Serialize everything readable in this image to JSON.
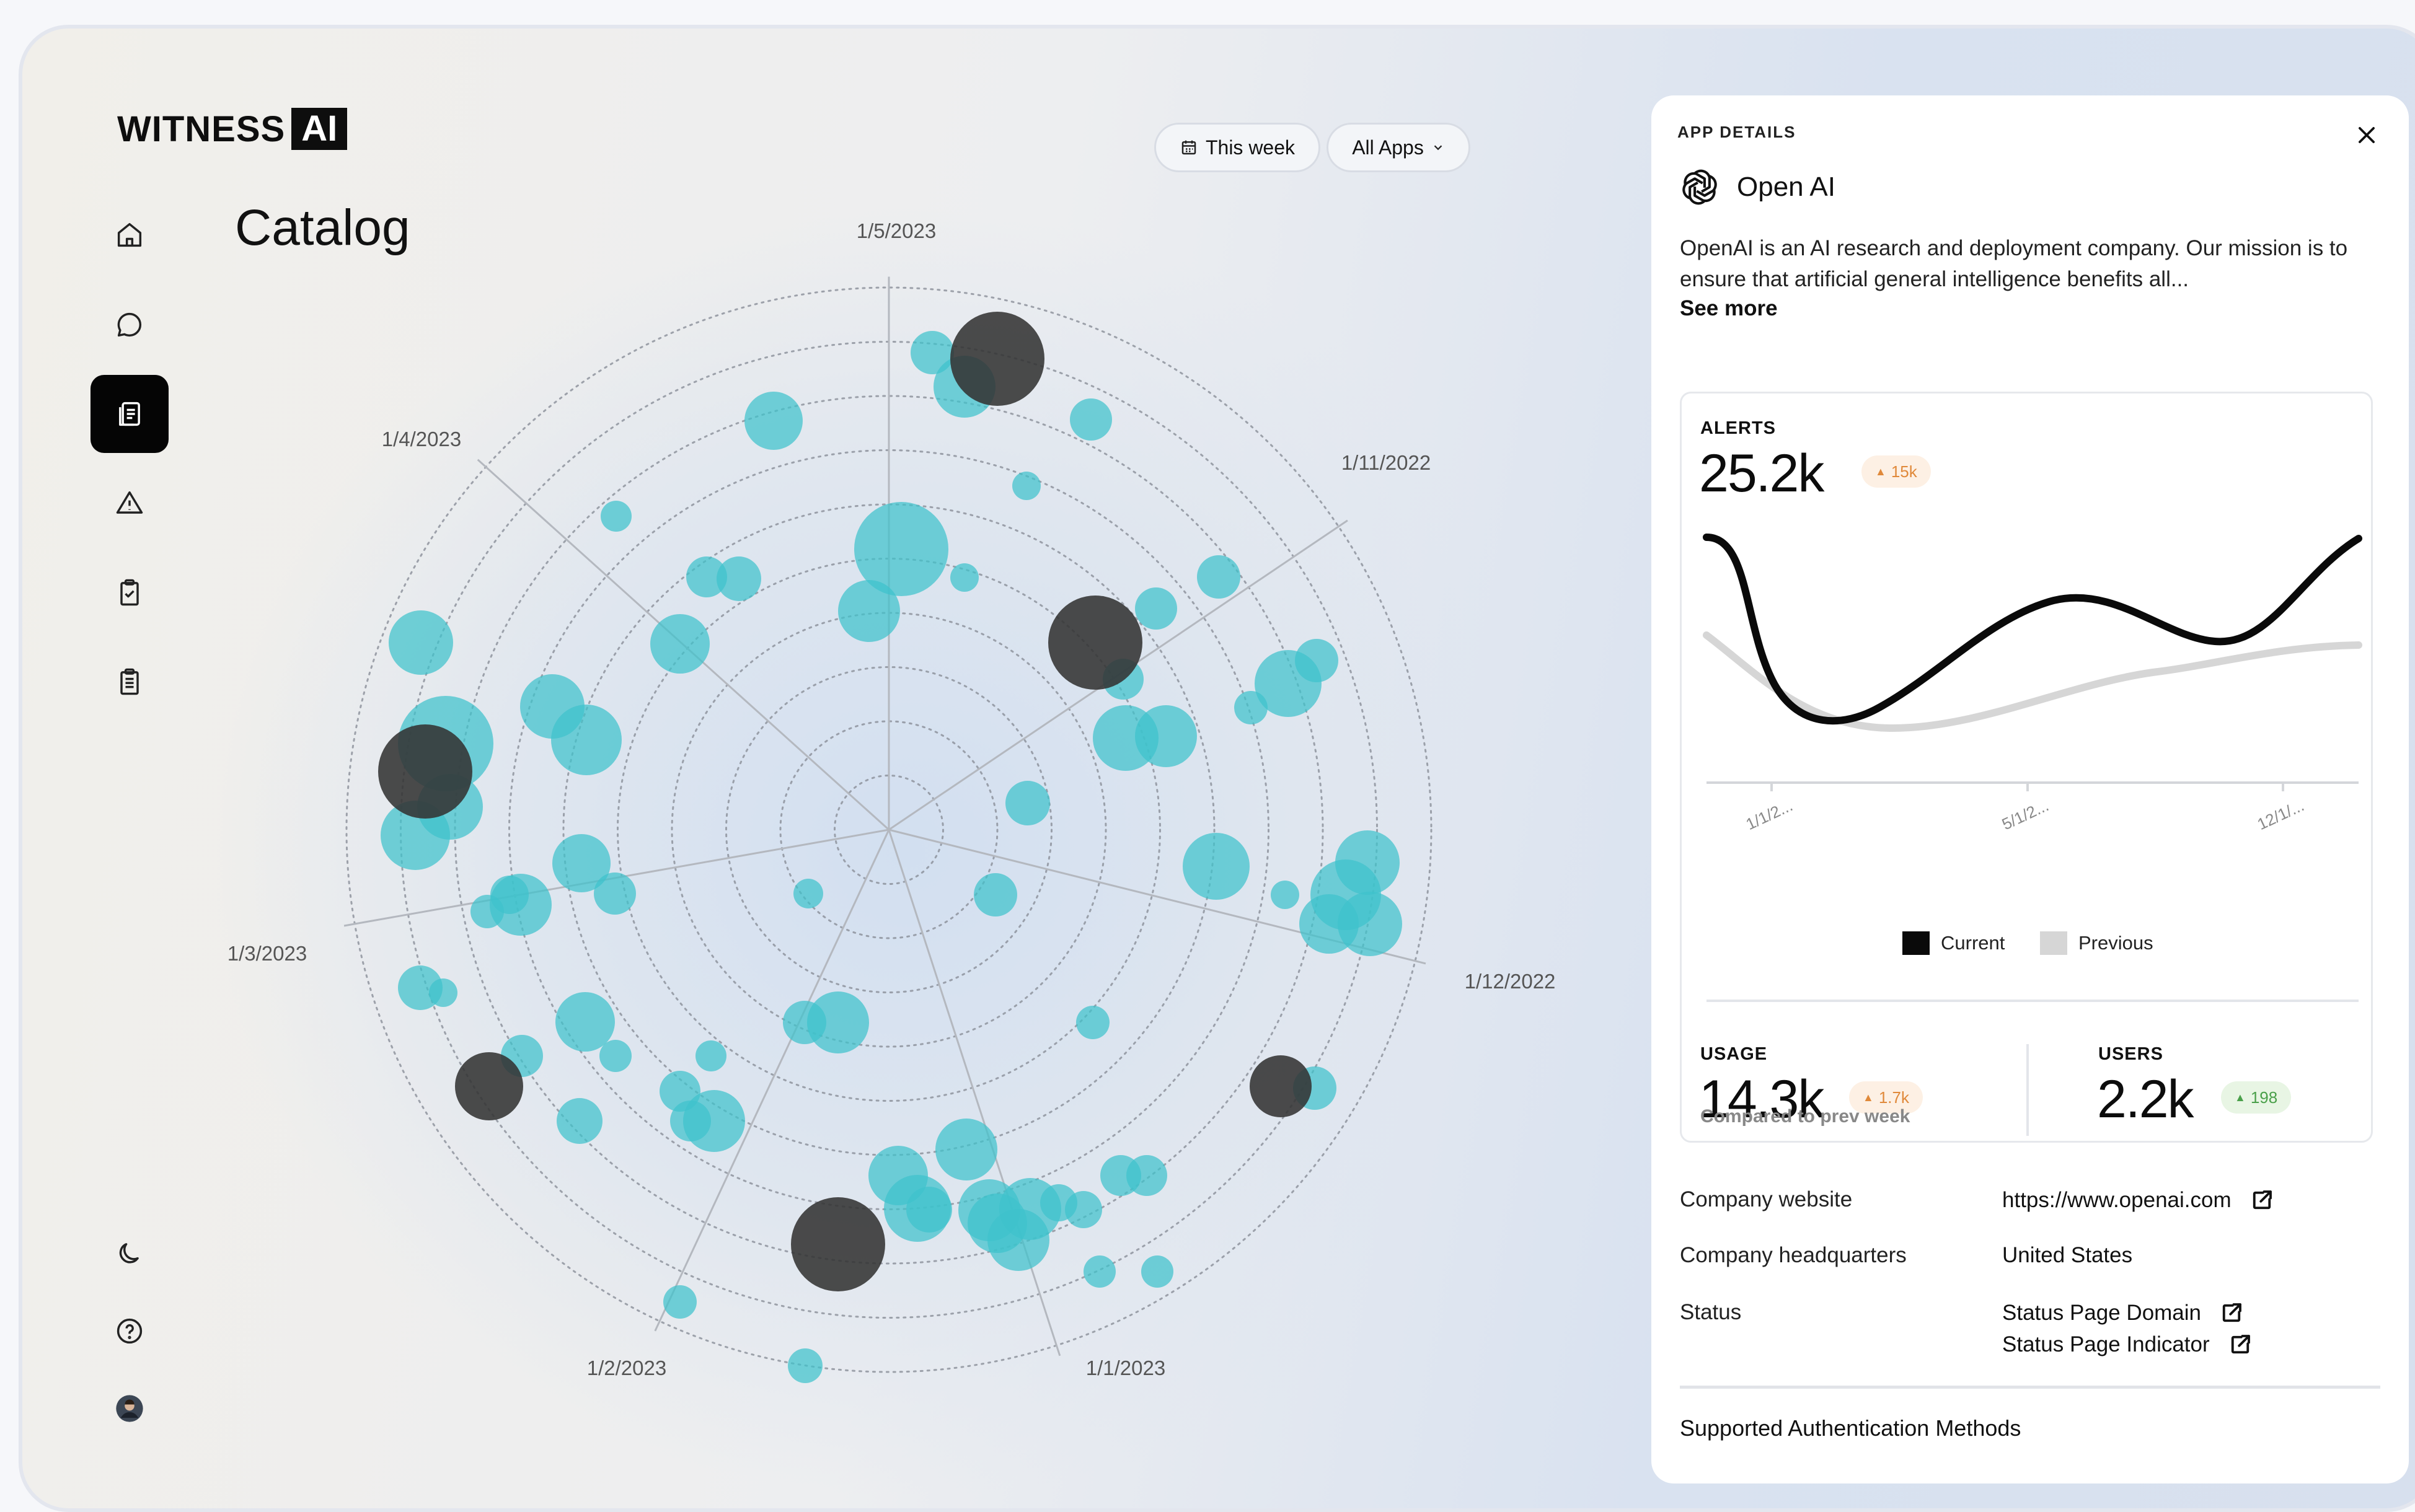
{
  "logo": {
    "text": "WITNESS",
    "badge": "AI"
  },
  "nav": {
    "items": [
      {
        "name": "home-icon",
        "active": false
      },
      {
        "name": "chat-icon",
        "active": false
      },
      {
        "name": "catalog-icon",
        "active": true
      },
      {
        "name": "alert-icon",
        "active": false
      },
      {
        "name": "clipboard-check-icon",
        "active": false
      },
      {
        "name": "clipboard-list-icon",
        "active": false
      }
    ],
    "bottom": [
      {
        "name": "dark-mode-icon"
      },
      {
        "name": "help-icon"
      },
      {
        "name": "user-avatar"
      }
    ]
  },
  "page_title": "Catalog",
  "filters": {
    "date_label": "This week",
    "apps_label": "All Apps"
  },
  "chart_data": {
    "type": "scatter",
    "subtype": "radial-bubble",
    "axis_labels": [
      "1/5/2023",
      "1/11/2022",
      "1/12/2022",
      "1/1/2023",
      "1/2/2023",
      "1/3/2023",
      "1/4/2023"
    ],
    "rings": 10,
    "colors": {
      "apps": "#3fc2cc",
      "highlighted": "#333333"
    },
    "bubbles": [
      {
        "cx": 1428,
        "cy": 567,
        "r": 72,
        "dark": true
      },
      {
        "cx": 1504,
        "cy": 574,
        "r": 0,
        "dark": false
      },
      {
        "cx": 1500,
        "cy": 573,
        "r": 0,
        "dark": false
      },
      {
        "cx": 1497,
        "cy": 573,
        "r": 0,
        "dark": false
      }
    ]
  },
  "panel": {
    "header": "APP DETAILS",
    "app_name": "Open AI",
    "description": "OpenAI is an AI research and deployment company. Our mission is to ensure that artificial general intelligence benefits all...",
    "see_more": "See more",
    "alerts": {
      "label": "ALERTS",
      "value": "25.2k",
      "delta": "15k"
    },
    "mini_chart": {
      "type": "line",
      "x_labels": [
        "1/1/2...",
        "5/1/2...",
        "12/1/..."
      ],
      "series": [
        {
          "name": "Current",
          "color": "#0a0a0a"
        },
        {
          "name": "Previous",
          "color": "#d6d6d6"
        }
      ]
    },
    "usage": {
      "label": "USAGE",
      "value": "14.3k",
      "delta": "1.7k"
    },
    "users": {
      "label": "USERS",
      "value": "2.2k",
      "delta": "198"
    },
    "compare_note": "Compared to prev week",
    "info": {
      "website_label": "Company website",
      "website_value": "https://www.openai.com",
      "hq_label": "Company headquarters",
      "hq_value": "United States",
      "status_label": "Status",
      "status_domain": "Status Page Domain",
      "status_indicator": "Status Page Indicator"
    },
    "auth_title": "Supported Authentication Methods"
  }
}
